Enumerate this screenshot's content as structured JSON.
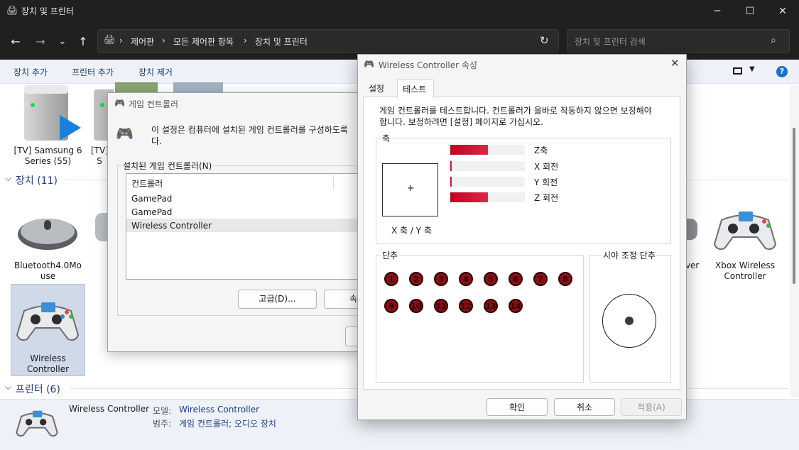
{
  "window": {
    "title": "장치 및 프린터",
    "controls": {
      "minimize": "─",
      "maximize": "☐",
      "close": "✕"
    }
  },
  "nav": {
    "back": "←",
    "forward": "→",
    "dropdown": "⌄",
    "up": "↑",
    "breadcrumbs": [
      "제어판",
      "모든 제어판 항목",
      "장치 및 프린터"
    ],
    "separator": "›",
    "search_placeholder": "장치 및 프린터 검색"
  },
  "commands": [
    "장치 추가",
    "프린터 추가",
    "장치 제거"
  ],
  "groups": {
    "devices": "장치 (11)",
    "printers": "프린터 (6)"
  },
  "devices": [
    {
      "label": "[TV] Samsung 6\nSeries (55)"
    },
    {
      "label": "[TV]\nS"
    },
    {
      "label": "Bluetooth4.0Mo\nuse"
    },
    {
      "label": "Wireless\nController"
    },
    {
      "label": "iver"
    },
    {
      "label": "Xbox Wireless\nController"
    }
  ],
  "details": {
    "name": "Wireless Controller",
    "model_label": "모델:",
    "model_value": "Wireless Controller",
    "category_label": "범주:",
    "category_value": "게임 컨트롤러; 오디오 장치"
  },
  "gc_dialog": {
    "title": "게임 컨트롤러",
    "description": "이 설정은 컴퓨터에 설치된 게임 컨트롤러를 구성하도록",
    "description2": "다.",
    "list_label": "설치된 게임 컨트롤러(N)",
    "column_header": "컨트롤러",
    "controllers": [
      "GamePad",
      "GamePad",
      "Wireless Controller"
    ],
    "advanced_button": "고급(D)...",
    "properties_button": "속"
  },
  "props_dialog": {
    "title": "Wireless Controller 속성",
    "tabs": [
      "설정",
      "테스트"
    ],
    "active_tab": "테스트",
    "instructions": "게임 컨트롤러를 테스트합니다. 컨트롤러가 올바로 작동하지 않으면 보정해야\n합니다. 보정하려면 [설정] 페이지로 가십시오.",
    "axes_label": "축",
    "xy_label": "X 축 / Y 축",
    "axis_bars": [
      {
        "label": "Z축",
        "level": 0.5
      },
      {
        "label": "X 회전",
        "level": 0.02
      },
      {
        "label": "Y 회전",
        "level": 0.02
      },
      {
        "label": "Z 회전",
        "level": 0.5
      }
    ],
    "buttons_label": "단추",
    "buttons": [
      "1",
      "2",
      "3",
      "4",
      "5",
      "6",
      "7",
      "8",
      "9",
      "10",
      "11",
      "12",
      "13",
      "14"
    ],
    "pov_label": "시야 조정 단추",
    "ok": "확인",
    "cancel": "취소",
    "apply": "적용(A)",
    "close": "✕"
  },
  "colors": {
    "accent": "#1f3c88",
    "bar": "#c5001f",
    "button": "#8a0e14"
  }
}
